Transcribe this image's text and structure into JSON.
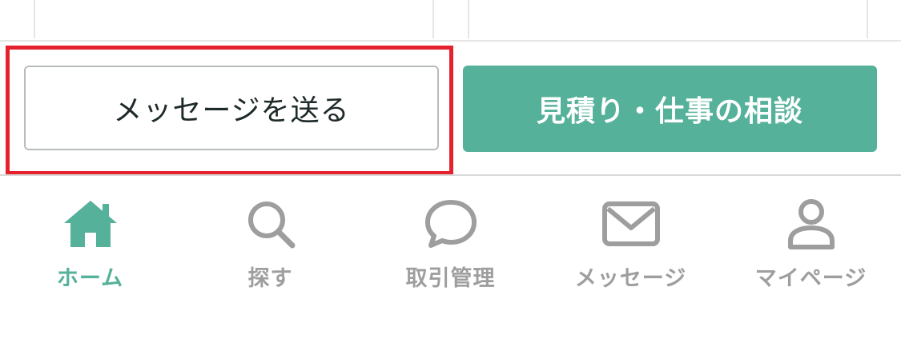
{
  "actions": {
    "message_button_label": "メッセージを送る",
    "estimate_button_label": "見積り・仕事の相談"
  },
  "bottom_nav": {
    "items": [
      {
        "label": "ホーム",
        "icon": "home-icon",
        "active": true
      },
      {
        "label": "探す",
        "icon": "search-icon",
        "active": false
      },
      {
        "label": "取引管理",
        "icon": "chat-bubble-icon",
        "active": false
      },
      {
        "label": "メッセージ",
        "icon": "envelope-icon",
        "active": false
      },
      {
        "label": "マイページ",
        "icon": "user-icon",
        "active": false
      }
    ]
  },
  "colors": {
    "accent": "#55b19a",
    "highlight": "#e5212e",
    "inactive": "#9e9e9e"
  }
}
